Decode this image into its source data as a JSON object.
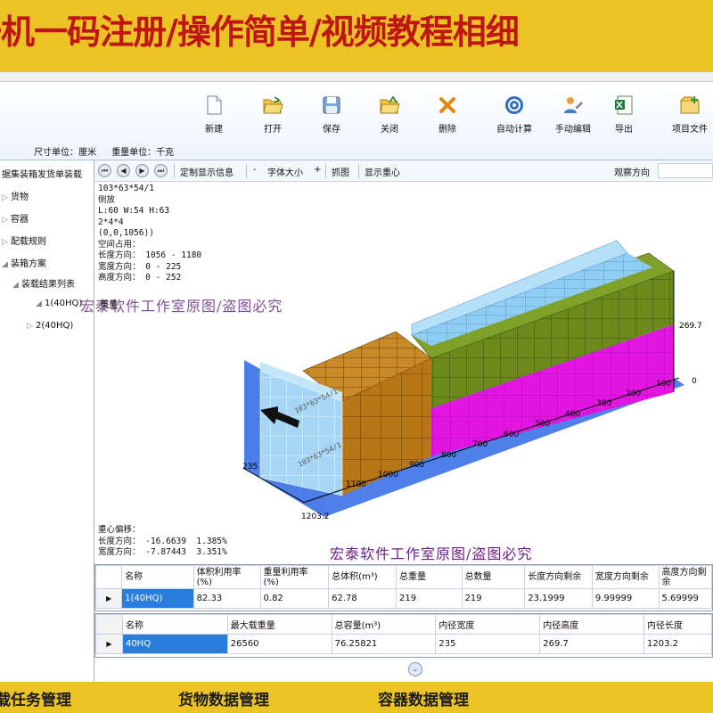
{
  "banner": {
    "text": "一机一码注册/操作简单/视频教程相细"
  },
  "toolbar": {
    "items": [
      {
        "label": "新建",
        "icon": "new-doc-icon"
      },
      {
        "label": "打开",
        "icon": "open-folder-icon"
      },
      {
        "label": "保存",
        "icon": "save-disk-icon"
      },
      {
        "label": "关闭",
        "icon": "close-folder-icon"
      },
      {
        "label": "删除",
        "icon": "delete-x-icon"
      },
      {
        "label": "自动计算",
        "icon": "auto-calc-icon"
      },
      {
        "label": "手动编辑",
        "icon": "manual-edit-icon"
      },
      {
        "label": "导出",
        "icon": "excel-export-icon"
      },
      {
        "label": "项目文件",
        "icon": "project-file-icon"
      }
    ],
    "size_unit": "尺寸单位：厘米",
    "weight_unit": "重量单位：千克"
  },
  "tree": {
    "title": "据集装箱发货单装载",
    "items": [
      {
        "label": "货物",
        "arrow": "▷"
      },
      {
        "label": "容器",
        "arrow": "▷"
      },
      {
        "label": "配载规则",
        "arrow": "▷"
      },
      {
        "label": "装箱方案",
        "arrow": "◢"
      },
      {
        "label": "装载结果列表",
        "arrow": "◢"
      },
      {
        "label": "1(40HQ)",
        "arrow": "◢"
      },
      {
        "label": "2(40HQ)",
        "arrow": "▷"
      }
    ]
  },
  "viewer": {
    "nav": [
      "⏮",
      "◀",
      "▶",
      "⏭"
    ],
    "custom_display": "定制显示信息",
    "minus": "-",
    "font_size": "字体大小",
    "plus": "+",
    "capture": "抓图",
    "show_gravity": "显示重心",
    "view_direction": "观察方向",
    "info_lines": "103*63*54/1\n侧放\nL:60 W:54 H:63\n2*4*4\n(0,0,1056))\n空间占用：\n长度方向： 1056 - 1180\n宽度方向： 0 - 225\n高度方向： 0 - 252",
    "center_lines": "重心偏移：\n长度方向： -16.6639  1.385%\n宽度方向： -7.87443  3.351%",
    "watermark": "宏泰软件工作室原图/盗图必究",
    "layer_label": "重量",
    "axis": {
      "height_max": "269.7",
      "height_min": "0",
      "width": "235",
      "length_end": "1203.2",
      "length_ticks": [
        "1100",
        "1000",
        "900",
        "800",
        "700",
        "600",
        "500",
        "400",
        "300",
        "200",
        "100",
        "0"
      ]
    },
    "box_label": "103*63*54/1",
    "colors": {
      "container_floor": "#4f7fe8",
      "container_back": "#4d7de6",
      "cargo_light_blue": "#a7d6f5",
      "cargo_brown": "#b87717",
      "cargo_olive": "#6b8a1b",
      "cargo_magenta": "#e117e1",
      "cargo_sky": "#8fcdf2"
    }
  },
  "result_table": {
    "headers": [
      "名称",
      "体积利用率 (%)",
      "重量利用率 (%)",
      "总体积(m³)",
      "总重量",
      "总数量",
      "长度方向剩余",
      "宽度方向剩余",
      "高度方向剩余"
    ],
    "rows": [
      [
        "1(40HQ)",
        "82.33",
        "0.82",
        "62.78",
        "219",
        "219",
        "23.1999",
        "9.99999",
        "5.69999"
      ]
    ]
  },
  "container_table": {
    "headers": [
      "名称",
      "最大载重量",
      "总容量(m³)",
      "内径宽度",
      "内径高度",
      "内径长度"
    ],
    "rows": [
      [
        "40HQ",
        "26560",
        "76.25821",
        "235",
        "269.7",
        "1203.2"
      ]
    ]
  },
  "expand": "⌄",
  "bottom_tabs": [
    "装载任务管理",
    "货物数据管理",
    "容器数据管理"
  ]
}
